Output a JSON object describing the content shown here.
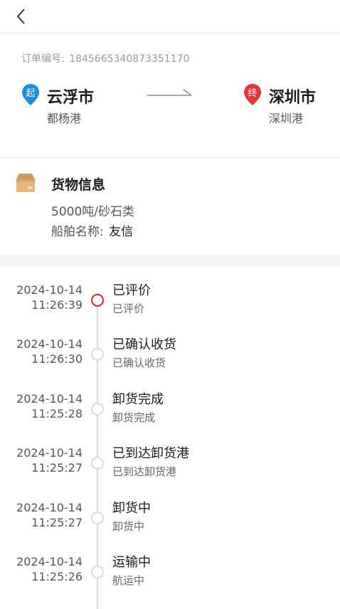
{
  "order": {
    "label": "订单编号:",
    "number": "1845665340873351170"
  },
  "route": {
    "origin": {
      "badge": "起",
      "city": "云浮市",
      "port": "都杨港",
      "color": "#1a8fe3"
    },
    "destination": {
      "badge": "终",
      "city": "深圳市",
      "port": "深圳港",
      "color": "#e5353a"
    }
  },
  "cargo": {
    "title": "货物信息",
    "spec": "5000吨/砂石类",
    "ship_label": "船舶名称:",
    "ship_name": "友信"
  },
  "timeline": [
    {
      "date": "2024-10-14",
      "time": "11:26:39",
      "status": "已评价",
      "desc": "已评价",
      "active": true
    },
    {
      "date": "2024-10-14",
      "time": "11:26:30",
      "status": "已确认收货",
      "desc": "已确认收货",
      "active": false
    },
    {
      "date": "2024-10-14",
      "time": "11:25:28",
      "status": "卸货完成",
      "desc": "卸货完成",
      "active": false
    },
    {
      "date": "2024-10-14",
      "time": "11:25:27",
      "status": "已到达卸货港",
      "desc": "已到达卸货港",
      "active": false
    },
    {
      "date": "2024-10-14",
      "time": "11:25:27",
      "status": "卸货中",
      "desc": "卸货中",
      "active": false
    },
    {
      "date": "2024-10-14",
      "time": "11:25:26",
      "status": "运输中",
      "desc": "航运中",
      "active": false
    }
  ],
  "colors": {
    "accent": "#c8283a",
    "muted": "#9a9a9a"
  }
}
